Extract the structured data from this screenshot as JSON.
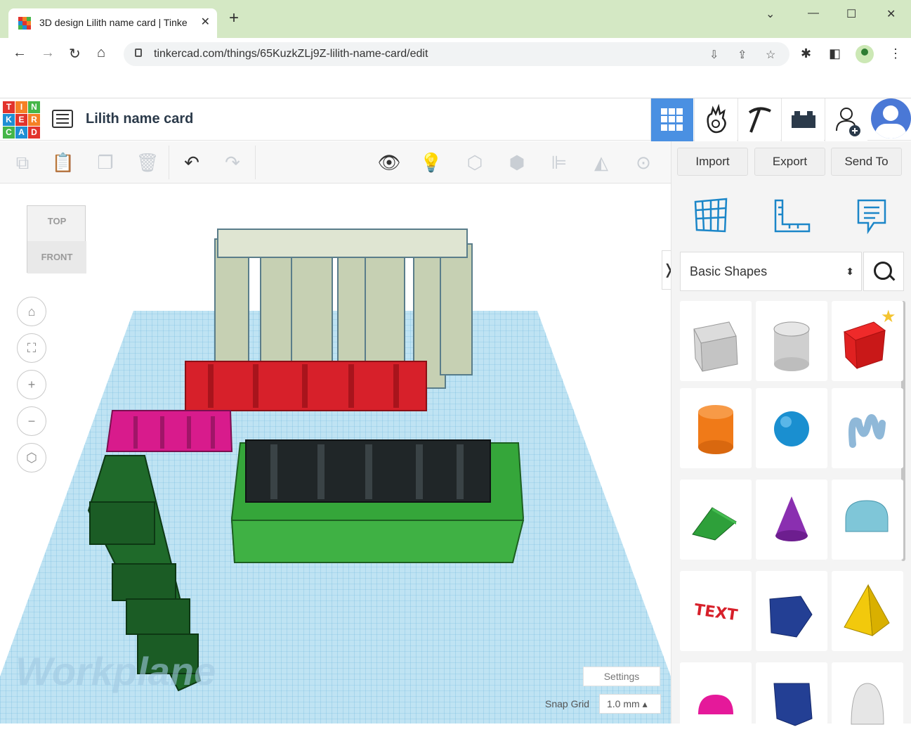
{
  "browser": {
    "tab_title": "3D design Lilith name card | Tinke",
    "tab_close": "✕",
    "new_tab": "+",
    "url": "tinkercad.com/things/65KuzkZLj9Z-lilith-name-card/edit",
    "window_controls": [
      "⌄",
      "—",
      "☐",
      "✕"
    ]
  },
  "app": {
    "logo_letters": [
      "T",
      "I",
      "N",
      "K",
      "E",
      "R",
      "C",
      "A",
      "D"
    ],
    "logo_colors": [
      "#e2332c",
      "#f58025",
      "#45b649",
      "#1f8fd4",
      "#e2332c",
      "#f58025",
      "#45b649",
      "#1f8fd4",
      "#e2332c"
    ],
    "design_title": "Lilith name card",
    "header_buttons": [
      "grid-view-icon",
      "tinker-hand-icon",
      "pickaxe-icon",
      "bricks-icon",
      "add-user-icon"
    ]
  },
  "toolbar": {
    "import_label": "Import",
    "export_label": "Export",
    "send_to_label": "Send To"
  },
  "viewport": {
    "viewcube_top": "TOP",
    "viewcube_front": "FRONT",
    "workplane_label": "Workplane",
    "settings_label": "Settings",
    "snap_grid_label": "Snap Grid",
    "snap_grid_value": "1.0 mm"
  },
  "library": {
    "category": "Basic Shapes",
    "shapes": [
      "box",
      "cylinder-hole",
      "box-favorite",
      "cylinder",
      "sphere",
      "scribble",
      "roof",
      "cone",
      "round-roof",
      "text",
      "wedge",
      "pyramid",
      "half-sphere",
      "polygon",
      "paraboloid"
    ]
  },
  "colors": {
    "accent": "#4a90e2",
    "workplane": "#a8d8ee",
    "grid_line": "#6fb8dc"
  }
}
